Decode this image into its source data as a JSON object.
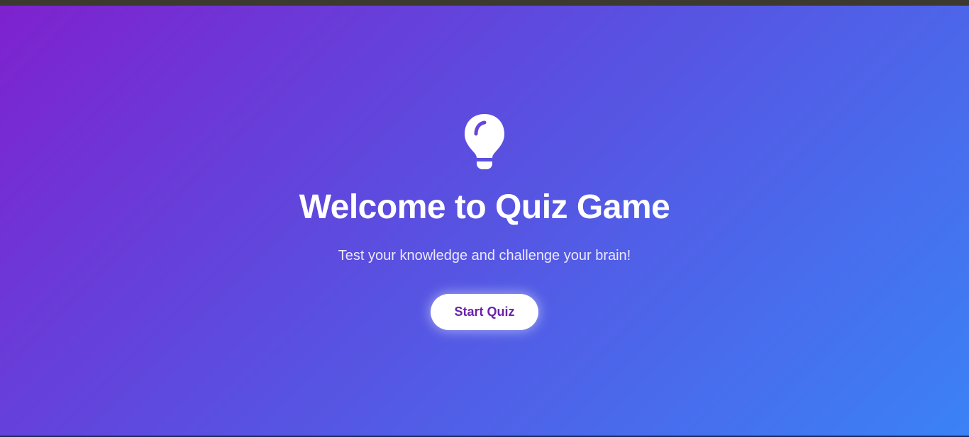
{
  "welcome": {
    "title": "Welcome to Quiz Game",
    "subtitle": "Test your knowledge and challenge your brain!",
    "start_label": "Start Quiz",
    "icon": "lightbulb-icon"
  },
  "colors": {
    "gradient_start": "#7e22ce",
    "gradient_mid": "#5a4fe0",
    "gradient_end": "#3b82f6",
    "button_text": "#6b21a8",
    "button_bg": "#ffffff"
  }
}
